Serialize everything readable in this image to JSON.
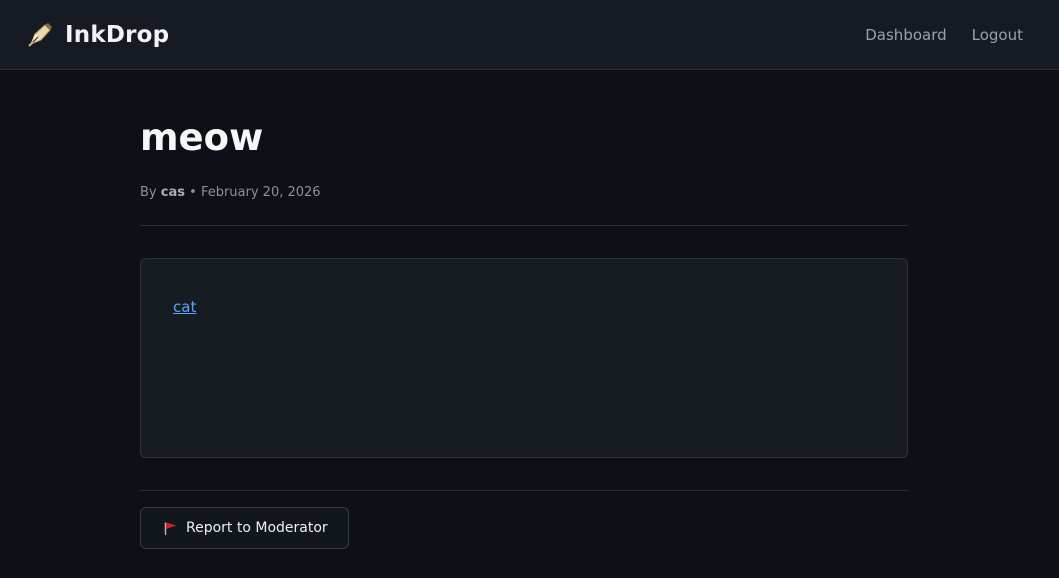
{
  "header": {
    "brand_name": "InkDrop",
    "brand_icon": "fountain-pen-icon",
    "nav": [
      {
        "label": "Dashboard"
      },
      {
        "label": "Logout"
      }
    ]
  },
  "post": {
    "title": "meow",
    "by_label": "By",
    "author": "cas",
    "separator": "•",
    "date": "February 20, 2026",
    "content_link_text": "cat"
  },
  "actions": {
    "report_label": "Report to Moderator",
    "report_icon": "red-flag-icon"
  },
  "colors": {
    "background": "#0d1017",
    "header_background": "#161a22",
    "card_background": "#171b22",
    "link": "#58a6ff",
    "flag": "#d4202a"
  }
}
